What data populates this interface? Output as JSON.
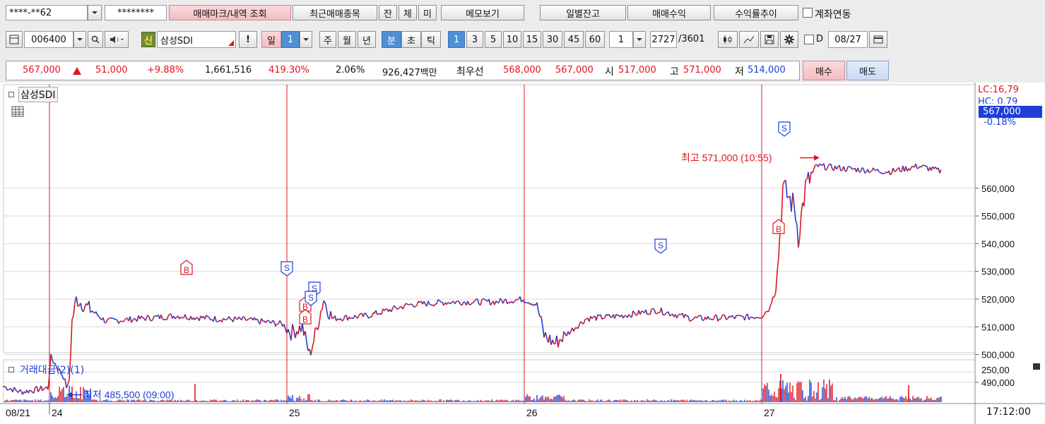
{
  "toolbar1": {
    "account_masked": "****-**62",
    "password_masked": "********",
    "mark_query": "매매마크/내역 조회",
    "recent_items": "최근매매종목",
    "tab_jan": "잔",
    "tab_che": "체",
    "tab_mi": "미",
    "memo": "메모보기",
    "daily_balance": "일별잔고",
    "trade_profit": "매매수익",
    "return_trend": "수익률추이",
    "account_link": "계좌연동"
  },
  "toolbar2": {
    "code": "006400",
    "new_badge": "신",
    "name": "삼성SDI",
    "exclaim": "!",
    "period_day": "일",
    "period_day_value": "1",
    "period_week": "주",
    "period_month": "월",
    "period_year": "년",
    "period_min": "분",
    "period_sec": "초",
    "period_tick": "틱",
    "intervals": [
      "1",
      "3",
      "5",
      "10",
      "15",
      "30",
      "45",
      "60"
    ],
    "interval_value": "1",
    "count_shown": "2727",
    "count_total": "/3601",
    "d_label": "D",
    "date": "08/27"
  },
  "quote": {
    "price": "567,000",
    "change": "51,000",
    "change_pct": "+9.88%",
    "volume": "1,661,516",
    "vol_ratio": "419.30%",
    "turnover": "2.06%",
    "amount": "926,427백만",
    "best_label": "최우선",
    "best_ask": "568,000",
    "best_bid": "567,000",
    "open_label": "시",
    "open": "517,000",
    "high_label": "고",
    "high": "571,000",
    "low_label": "저",
    "low": "514,000",
    "buy": "매수",
    "sell": "매도"
  },
  "chart": {
    "main_title": "삼성SDI",
    "volume_title": "거래대금(2)(1)",
    "lc_label": "LC:16,79",
    "hc_label": "HC: 0.79",
    "current_price_label": "567,000",
    "current_change_label": "-0.18%",
    "y_ticks": [
      "560,000",
      "550,000",
      "540,000",
      "530,000",
      "520,000",
      "510,000",
      "500,000",
      "490,000"
    ],
    "vol_tick": "250,00",
    "max_annotation": "최고 571,000 (10:55)",
    "min_annotation": "최저 485,500 (09:00)",
    "x_labels": [
      "08/21",
      "24",
      "25",
      "26",
      "27"
    ],
    "time_label": "17:12:00",
    "marker_b": "B",
    "marker_s": "S",
    "colors": {
      "up": "#e0141e",
      "down": "#1d3fd6",
      "grid": "#d9d9d9",
      "sep": "#e0141e"
    }
  }
}
